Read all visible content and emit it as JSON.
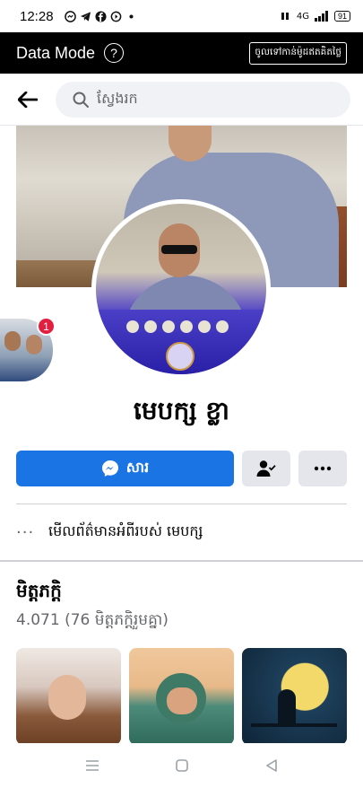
{
  "status_bar": {
    "time": "12:28",
    "network": "4G",
    "battery": "91"
  },
  "data_mode": {
    "title": "Data Mode",
    "help_symbol": "?",
    "free_button_label": "ចូលទៅកាន់ម៉ូដឥតគិតថ្លៃ"
  },
  "search": {
    "placeholder": "ស្វែងរក"
  },
  "profile": {
    "name": "មេបក្ស ខ្លា",
    "story_badge_count": "1",
    "message_button_label": "សារ",
    "about_text": "មើលព័ត៌មានអំពីរបស់ មេបក្ស",
    "about_dots": "···"
  },
  "friends": {
    "title": "មិត្តភក្តិ",
    "count_text": "4.071 (76 មិត្តភក្តិរួមគ្នា)"
  },
  "icons": {
    "back": "arrow-left-icon",
    "search": "search-icon",
    "messenger": "messenger-icon",
    "friend_status": "person-check-icon",
    "more": "more-icon"
  },
  "colors": {
    "primary": "#1b74e4",
    "badge": "#e41e3f",
    "data_bar": "#000000"
  }
}
